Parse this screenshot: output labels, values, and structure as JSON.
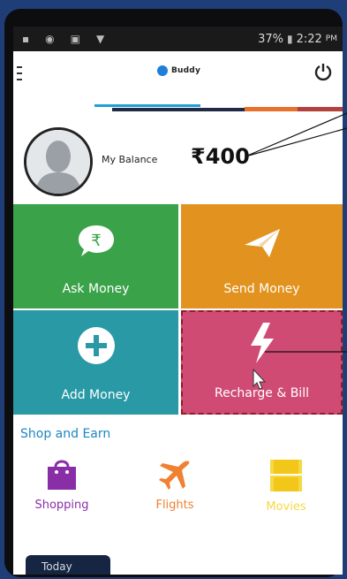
{
  "status_bar": {
    "battery": "37%",
    "time": "2:22",
    "time_suffix": "PM"
  },
  "app": {
    "brand": "Buddy"
  },
  "balance": {
    "label": "My Balance",
    "amount": "₹400"
  },
  "tiles": [
    {
      "label": "Ask Money",
      "color": "#3aa34a",
      "icon": "rupee-chat-icon"
    },
    {
      "label": "Send Money",
      "color": "#e2921f",
      "icon": "paper-plane-icon"
    },
    {
      "label": "Add Money",
      "color": "#2999a6",
      "icon": "plus-circle-icon"
    },
    {
      "label": "Recharge & Bill",
      "color": "#d04b73",
      "icon": "lightning-icon"
    }
  ],
  "shop": {
    "title": "Shop and Earn",
    "items": [
      {
        "label": "Shopping",
        "color": "#8a2ea8",
        "icon": "shopping-bag-icon"
      },
      {
        "label": "Flights",
        "color": "#f08032",
        "icon": "airplane-icon"
      },
      {
        "label": "Movies",
        "color": "#f5d843",
        "icon": "film-icon"
      }
    ]
  },
  "bottom": {
    "tab": "Today"
  }
}
